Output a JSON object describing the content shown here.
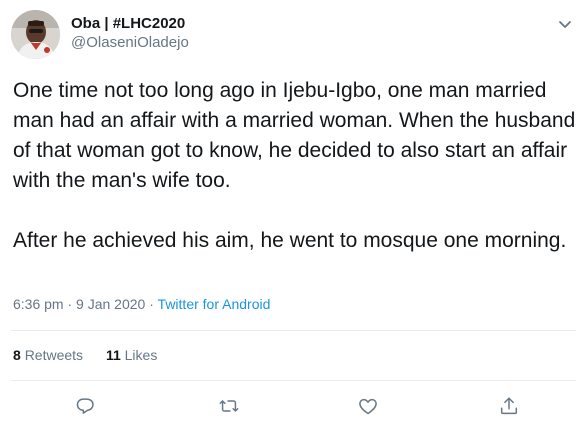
{
  "author": {
    "display_name": "Oba | #LHC2020",
    "handle": "@OlaseniOladejo"
  },
  "tweet": {
    "paragraphs": [
      "One time not too long ago in Ijebu-Igbo, one man married man had an affair with a married woman. When the husband of that woman got to know, he decided to also start an affair with the man's wife too.",
      "After he achieved his aim, he went to mosque one morning."
    ],
    "time": "6:36 pm",
    "date": "9 Jan 2020",
    "separator": "·",
    "source": "Twitter for Android"
  },
  "stats": {
    "retweets_count": "8",
    "retweets_label": "Retweets",
    "likes_count": "11",
    "likes_label": "Likes"
  },
  "actions": {
    "reply_icon": "reply-icon",
    "retweet_icon": "retweet-icon",
    "like_icon": "heart-icon",
    "share_icon": "share-icon"
  },
  "colors": {
    "text_primary": "#14171a",
    "text_secondary": "#657786",
    "link": "#1b95e0",
    "divider": "#e6ecf0"
  }
}
